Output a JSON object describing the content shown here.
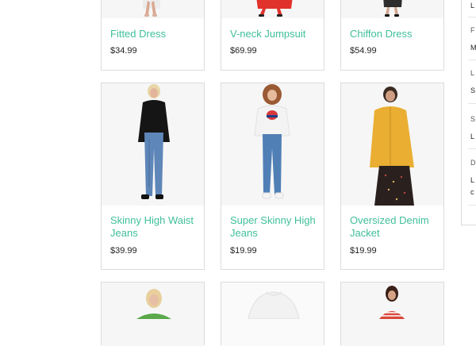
{
  "products": [
    {
      "name": "Fitted Dress",
      "price": "$34.99"
    },
    {
      "name": "V-neck Jumpsuit",
      "price": "$69.99"
    },
    {
      "name": "Chiffon Dress",
      "price": "$54.99"
    },
    {
      "name": "Skinny High Waist Jeans",
      "price": "$39.99"
    },
    {
      "name": "Super Skinny High Jeans",
      "price": "$19.99"
    },
    {
      "name": "Oversized Denim Jacket",
      "price": "$19.99"
    }
  ],
  "colors": {
    "accent": "#3fbf9b",
    "text": "#222222",
    "border": "#dcdcdc"
  }
}
